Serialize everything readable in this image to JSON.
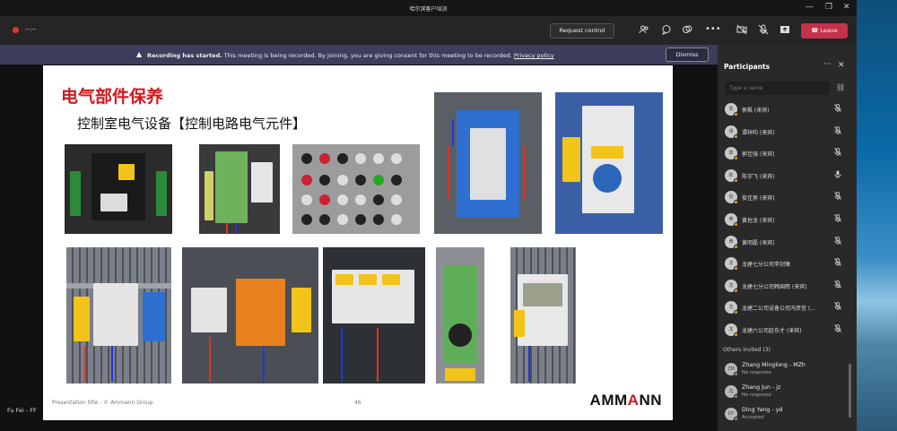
{
  "window": {
    "title": "哈尔滨客户培训",
    "minimize": "—",
    "restore": "❐",
    "close": "✕"
  },
  "toolbar": {
    "recording_time": "--:--",
    "request_control": "Request control",
    "leave": "Leave",
    "icons": [
      "people-icon",
      "chat-icon",
      "reactions-icon",
      "more-icon",
      "camera-off-icon",
      "mic-off-icon",
      "share-icon"
    ]
  },
  "banner": {
    "bold": "Recording has started.",
    "message": " This meeting is being recorded. By joining, you are giving consent for this meeting to be recorded. ",
    "link": "Privacy policy",
    "dismiss": "Dismiss"
  },
  "slide": {
    "title": "电气部件保养",
    "subtitle": "控制室电气设备【控制电路电气元件】",
    "footer": "Presentation title - © Ammann Group",
    "page": "46",
    "brand": "AMMANN"
  },
  "presenter": "Fu Fei - FF",
  "panel": {
    "title": "Participants",
    "search_placeholder": "Type a name",
    "participants": [
      {
        "name": "郭枫 (来宾)",
        "initials": "郭"
      },
      {
        "name": "谭祥昀 (来宾)",
        "initials": "谭"
      },
      {
        "name": "郭佳强 (来宾)",
        "initials": "郭"
      },
      {
        "name": "陈宇飞 (来宾)",
        "initials": "陈"
      },
      {
        "name": "俊佳男 (来宾)",
        "initials": "俊"
      },
      {
        "name": "黄佐龙 (来宾)",
        "initials": "黄"
      },
      {
        "name": "黄明磊 (来宾)",
        "initials": "黄"
      },
      {
        "name": "龙建七分公司李剑锋",
        "initials": "龙"
      },
      {
        "name": "龙建七分公司韩国辉 (来宾)",
        "initials": "龙"
      },
      {
        "name": "龙建二公司设备公司冯彦宫 (...",
        "initials": "龙"
      },
      {
        "name": "龙建六公司赵东才 (来宾)",
        "initials": "龙"
      }
    ],
    "others_invited": "Others invited (3)",
    "invited": [
      {
        "name": "Zhang Minglong - MZh",
        "status": "No response",
        "initials": "ZM"
      },
      {
        "name": "Zhang Jun - jz",
        "status": "No response",
        "initials": "ZJ"
      },
      {
        "name": "Ding Yang - yd",
        "status": "Accepted",
        "initials": "DY"
      }
    ]
  }
}
